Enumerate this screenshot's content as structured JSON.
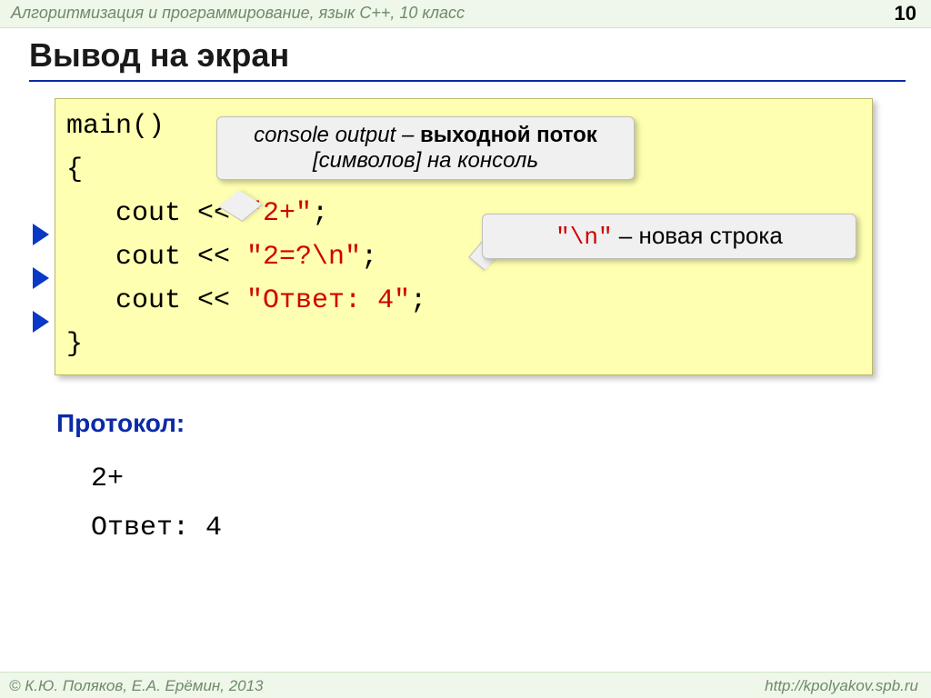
{
  "header": {
    "caption": "Алгоритмизация и программирование, язык  C++, 10 класс",
    "page": "10"
  },
  "title": "Вывод на экран",
  "code": {
    "l1": "main()",
    "l2": "{",
    "l3a": "   cout << ",
    "l3b": "\"2+\"",
    "l3c": ";",
    "l4a": "   cout << ",
    "l4b": "\"2=?\\n\"",
    "l4c": ";",
    "l5a": "   cout << ",
    "l5b": "\"Ответ: 4\"",
    "l5c": ";",
    "l6": "}"
  },
  "callout1": {
    "part1": "console output",
    "part2": " – ",
    "part3": "выходной поток",
    "part4": " [символов] на консоль"
  },
  "callout2": {
    "mono": "\"\\n\"",
    "rest": " – новая строка"
  },
  "protocol": {
    "label": "Протокол:",
    "line1": "2+",
    "line2": "Ответ: 4"
  },
  "footer": {
    "left": "© К.Ю. Поляков, Е.А. Ерёмин, 2013",
    "right": "http://kpolyakov.spb.ru"
  }
}
